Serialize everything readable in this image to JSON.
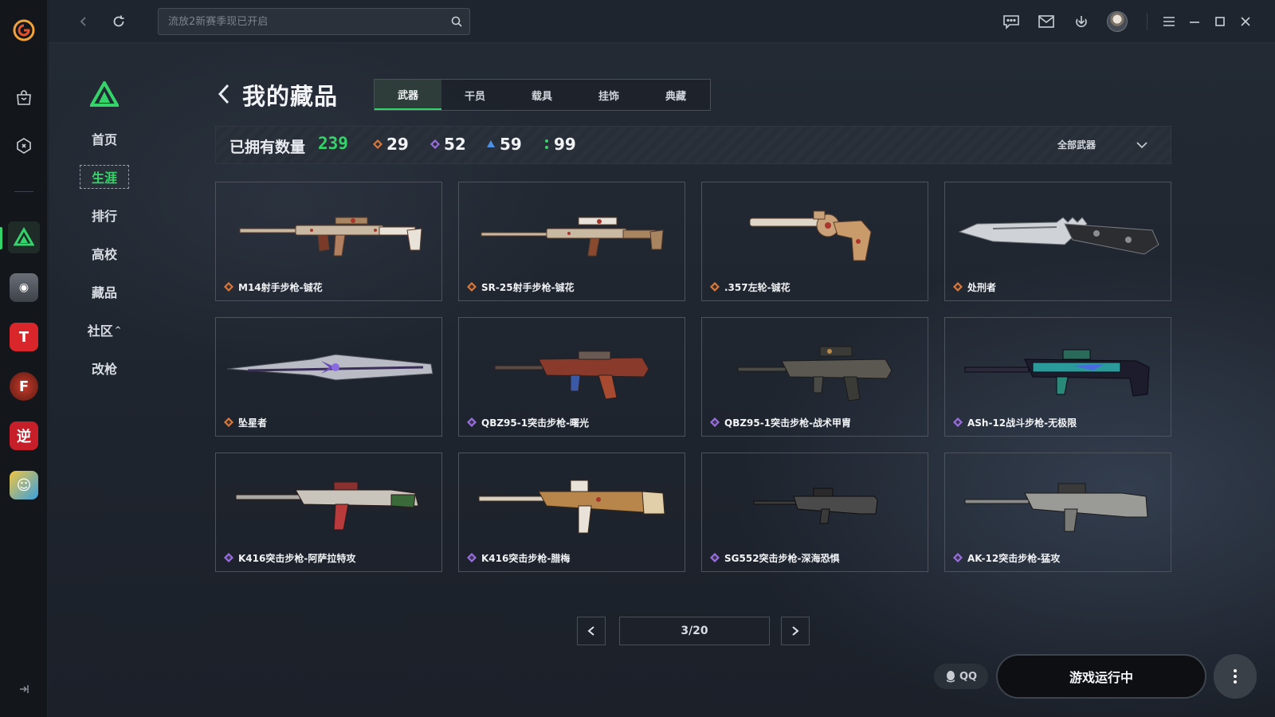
{
  "topbar": {
    "search_placeholder": "流放2新赛季现已开启"
  },
  "nav": {
    "items": [
      {
        "label": "首页",
        "active": false
      },
      {
        "label": "生涯",
        "active": true
      },
      {
        "label": "排行",
        "active": false
      },
      {
        "label": "高校",
        "active": false
      },
      {
        "label": "藏品",
        "active": false
      },
      {
        "label": "社区",
        "active": false,
        "caret": "^"
      },
      {
        "label": "改枪",
        "active": false
      }
    ]
  },
  "page": {
    "title": "我的藏品",
    "tabs": [
      {
        "label": "武器",
        "active": true
      },
      {
        "label": "干员",
        "active": false
      },
      {
        "label": "载具",
        "active": false
      },
      {
        "label": "挂饰",
        "active": false
      },
      {
        "label": "典藏",
        "active": false
      }
    ]
  },
  "stats": {
    "owned_label": "已拥有数量",
    "owned_count": "239",
    "rarity_counts": [
      {
        "rarity": "orange",
        "color": "#d9783a",
        "count": "29"
      },
      {
        "rarity": "purple",
        "color": "#9a6ee0",
        "count": "52"
      },
      {
        "rarity": "blue",
        "color": "#4d8fe0",
        "count": "59"
      },
      {
        "rarity": "green",
        "color": "#35d46a",
        "count": "99"
      }
    ],
    "filter_label": "全部武器"
  },
  "items": [
    {
      "name": "M14射手步枪-铖花",
      "rarity": "orange",
      "weapon_icon": "rifle-icon"
    },
    {
      "name": "SR-25射手步枪-铖花",
      "rarity": "orange",
      "weapon_icon": "rifle-icon"
    },
    {
      "name": ".357左轮-铖花",
      "rarity": "orange",
      "weapon_icon": "revolver-icon"
    },
    {
      "name": "处刑者",
      "rarity": "orange",
      "weapon_icon": "knife-icon"
    },
    {
      "name": "坠星者",
      "rarity": "orange",
      "weapon_icon": "blade-icon"
    },
    {
      "name": "QBZ95-1突击步枪-曙光",
      "rarity": "purple",
      "weapon_icon": "rifle-icon"
    },
    {
      "name": "QBZ95-1突击步枪-战术甲胄",
      "rarity": "purple",
      "weapon_icon": "rifle-icon"
    },
    {
      "name": "ASh-12战斗步枪-无极限",
      "rarity": "purple",
      "weapon_icon": "rifle-icon"
    },
    {
      "name": "K416突击步枪-阿萨拉特攻",
      "rarity": "purple",
      "weapon_icon": "rifle-icon"
    },
    {
      "name": "K416突击步枪-腊梅",
      "rarity": "purple",
      "weapon_icon": "rifle-icon"
    },
    {
      "name": "SG552突击步枪-深海恐惧",
      "rarity": "purple",
      "weapon_icon": "rifle-icon"
    },
    {
      "name": "AK-12突击步枪-猛攻",
      "rarity": "purple",
      "weapon_icon": "rifle-icon"
    }
  ],
  "pagination": {
    "text": "3/20"
  },
  "footer": {
    "qq_label": "QQ",
    "game_status": "游戏运行中"
  }
}
